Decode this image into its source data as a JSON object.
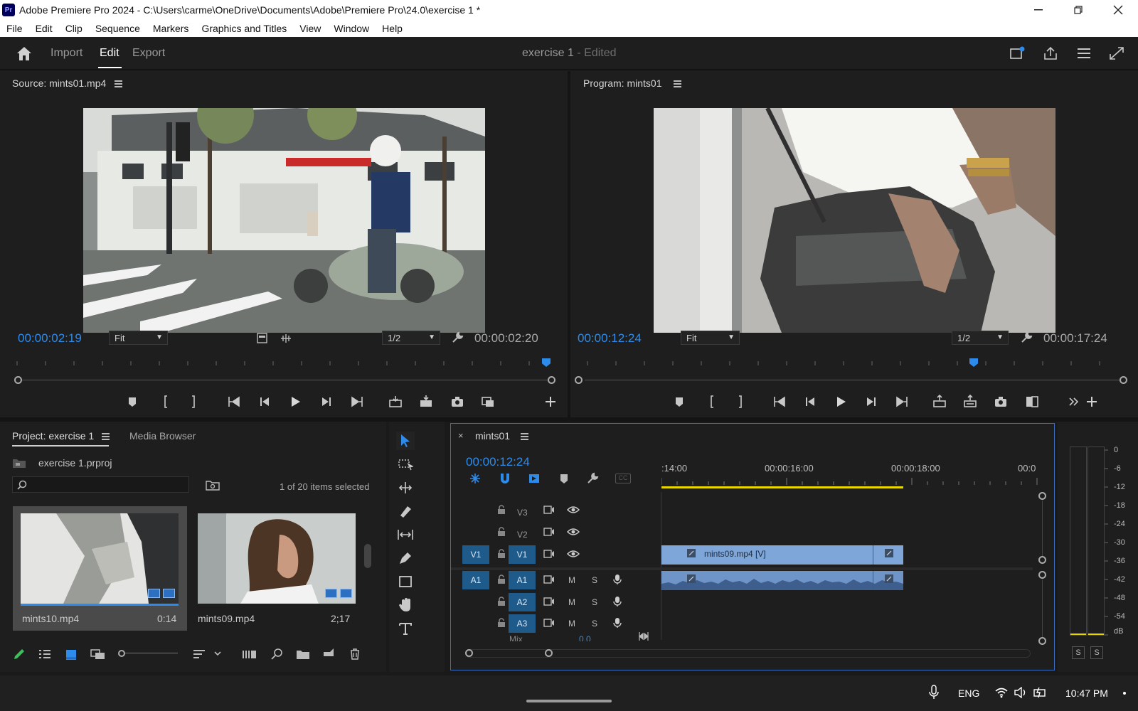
{
  "window": {
    "title": "Adobe Premiere Pro 2024 - C:\\Users\\carme\\OneDrive\\Documents\\Adobe\\Premiere Pro\\24.0\\exercise 1 *",
    "logo_text": "Pr"
  },
  "menu": [
    "File",
    "Edit",
    "Clip",
    "Sequence",
    "Markers",
    "Graphics and Titles",
    "View",
    "Window",
    "Help"
  ],
  "header": {
    "tabs": {
      "import": "Import",
      "edit": "Edit",
      "export": "Export"
    },
    "project_title": "exercise 1",
    "project_status": "- Edited"
  },
  "source_monitor": {
    "title": "Source: mints01.mp4",
    "timecode_current": "00:00:02:19",
    "timecode_duration": "00:00:02:20",
    "zoom": "Fit",
    "resolution": "1/2"
  },
  "program_monitor": {
    "title": "Program: mints01",
    "timecode_current": "00:00:12:24",
    "timecode_duration": "00:00:17:24",
    "zoom": "Fit",
    "resolution": "1/2"
  },
  "project_panel": {
    "tabs": {
      "project": "Project: exercise 1",
      "media_browser": "Media Browser"
    },
    "file": "exercise 1.prproj",
    "selection_status": "1 of 20 items selected",
    "items": [
      {
        "name": "mints10.mp4",
        "duration": "0:14"
      },
      {
        "name": "mints09.mp4",
        "duration": "2;17"
      }
    ]
  },
  "timeline": {
    "sequence_name": "mints01",
    "close_glyph": "×",
    "timecode": "00:00:12:24",
    "cc_label": "CC",
    "ruler_labels": [
      ":14:00",
      "00:00:16:00",
      "00:00:18:00",
      "00:0"
    ],
    "tracks": {
      "v3": "V3",
      "v2": "V2",
      "v1": "V1",
      "a1": "A1",
      "a2": "A2",
      "a3": "A3",
      "mix": "Mix",
      "mix_value": "0.0"
    },
    "mute": "M",
    "solo": "S",
    "clip_v1": "mints09.mp4 [V]"
  },
  "meters": {
    "db_labels": [
      "0",
      "-6",
      "-12",
      "-18",
      "-24",
      "-30",
      "-36",
      "-42",
      "-48",
      "-54",
      "dB"
    ],
    "solo_left": "S",
    "solo_right": "S"
  },
  "system": {
    "language": "ENG",
    "time": "10:47 PM"
  },
  "colors": {
    "accent_blue": "#2d8ceb",
    "clip_blue": "#7fa6d9",
    "track_blue": "#1e5a8a",
    "work_area_yellow": "#e8d800"
  }
}
